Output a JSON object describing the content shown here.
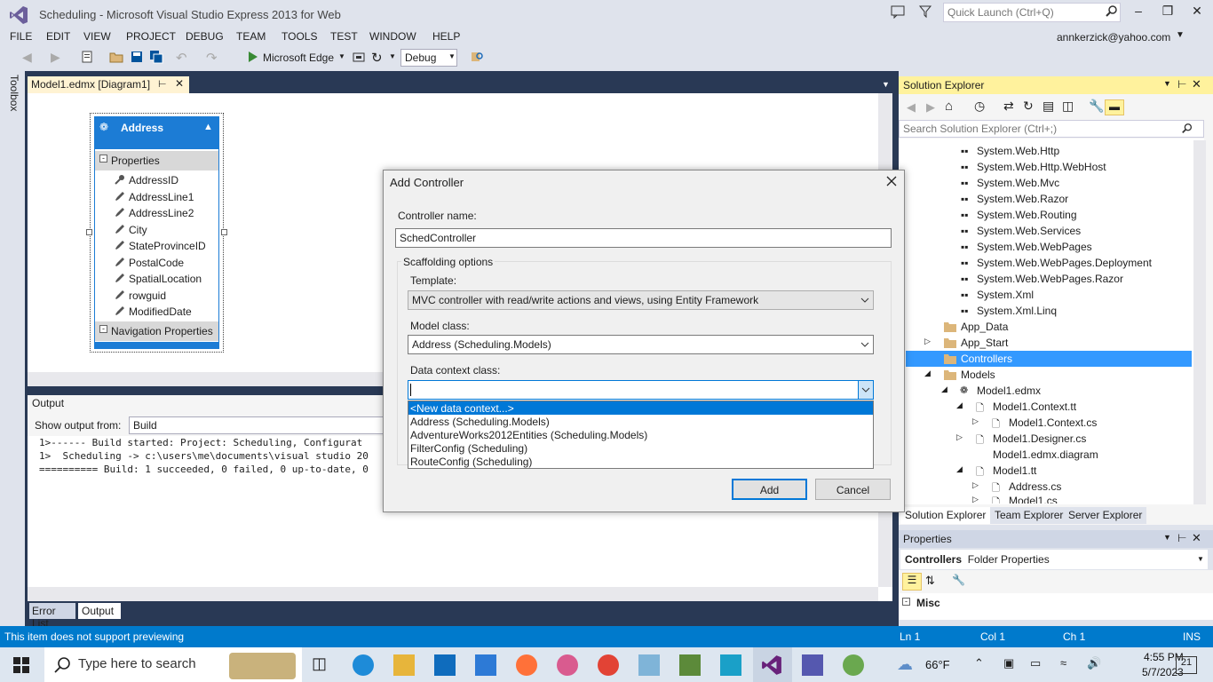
{
  "window": {
    "title": "Scheduling - Microsoft Visual Studio Express 2013 for Web",
    "quick_launch_placeholder": "Quick Launch (Ctrl+Q)",
    "account": "annkerzick@yahoo.com"
  },
  "menu": [
    "FILE",
    "EDIT",
    "VIEW",
    "PROJECT",
    "DEBUG",
    "TEAM",
    "TOOLS",
    "TEST",
    "WINDOW",
    "HELP"
  ],
  "toolbar": {
    "run_target": "Microsoft Edge",
    "configuration": "Debug"
  },
  "toolbox_label": "Toolbox",
  "doc_tab": {
    "title": "Model1.edmx [Diagram1]"
  },
  "entity": {
    "name": "Address",
    "section_properties": "Properties",
    "properties": [
      "AddressID",
      "AddressLine1",
      "AddressLine2",
      "City",
      "StateProvinceID",
      "PostalCode",
      "SpatialLocation",
      "rowguid",
      "ModifiedDate"
    ],
    "section_navigation": "Navigation Properties"
  },
  "output": {
    "title": "Output",
    "show_from_label": "Show output from:",
    "source": "Build",
    "lines": [
      "1>------ Build started: Project: Scheduling, Configurat",
      "1>  Scheduling -> c:\\users\\me\\documents\\visual studio 20",
      "========== Build: 1 succeeded, 0 failed, 0 up-to-date, 0"
    ],
    "tabs": [
      "Error List",
      "Output"
    ]
  },
  "dialog": {
    "title": "Add Controller",
    "controller_name_label": "Controller name:",
    "controller_name_value": "SchedController",
    "scaffolding_label": "Scaffolding options",
    "template_label": "Template:",
    "template_value": "MVC controller with read/write actions and views, using Entity Framework",
    "model_class_label": "Model class:",
    "model_class_value": "Address (Scheduling.Models)",
    "data_context_label": "Data context class:",
    "data_context_value": "",
    "data_context_options": [
      "<New data context...>",
      "Address (Scheduling.Models)",
      "AdventureWorks2012Entities (Scheduling.Models)",
      "FilterConfig (Scheduling)",
      "RouteConfig (Scheduling)"
    ],
    "add_label": "Add",
    "cancel_label": "Cancel"
  },
  "solution_explorer": {
    "title": "Solution Explorer",
    "search_placeholder": "Search Solution Explorer (Ctrl+;)",
    "references": [
      "System.Web.Http",
      "System.Web.Http.WebHost",
      "System.Web.Mvc",
      "System.Web.Razor",
      "System.Web.Routing",
      "System.Web.Services",
      "System.Web.WebPages",
      "System.Web.WebPages.Deployment",
      "System.Web.WebPages.Razor",
      "System.Xml",
      "System.Xml.Linq"
    ],
    "folders": [
      "App_Data",
      "App_Start",
      "Controllers",
      "Models"
    ],
    "selected": "Controllers",
    "model_files": [
      "Model1.edmx",
      "Model1.Context.tt",
      "Model1.Context.cs",
      "Model1.Designer.cs",
      "Model1.edmx.diagram",
      "Model1.tt",
      "Address.cs",
      "Model1.cs"
    ],
    "tabs": [
      "Solution Explorer",
      "Team Explorer",
      "Server Explorer"
    ]
  },
  "properties": {
    "title": "Properties",
    "object_name": "Controllers",
    "object_type": "Folder Properties",
    "category": "Misc"
  },
  "status": {
    "message": "This item does not support previewing",
    "ln": "Ln 1",
    "col": "Col 1",
    "ch": "Ch 1",
    "mode": "INS"
  },
  "taskbar": {
    "search_placeholder": "Type here to search",
    "weather": "66°F",
    "time": "4:55 PM",
    "date": "5/7/2023",
    "notifications": "21"
  },
  "colors": {
    "accent": "#007acc",
    "selection": "#3399ff",
    "entity": "#1c7cd5",
    "panel_highlight": "#fff29d"
  }
}
